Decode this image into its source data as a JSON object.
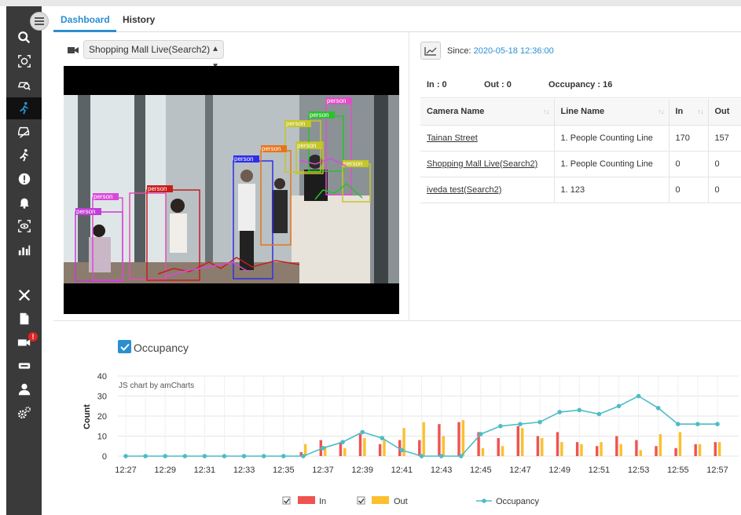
{
  "tabs": {
    "dashboard": "Dashboard",
    "history": "History"
  },
  "camera": {
    "selected": "Shopping Mall Live(Search2)"
  },
  "detections": [
    "person",
    "person",
    "person",
    "person",
    "person",
    "person",
    "person",
    "person",
    "person",
    "person"
  ],
  "since": {
    "label": "Since:",
    "value": "2020-05-18 12:36:00"
  },
  "summary": {
    "in": "In : 0",
    "out": "Out : 0",
    "occupancy": "Occupancy : 16"
  },
  "table": {
    "headers": [
      "Camera Name",
      "Line Name",
      "In",
      "Out"
    ],
    "rows": [
      [
        "Tainan Street",
        "1. People Counting Line",
        "170",
        "157"
      ],
      [
        "Shopping Mall Live(Search2)",
        "1. People Counting Line",
        "0",
        "0"
      ],
      [
        "iveda test(Search2)",
        "1. 123",
        "0",
        "0"
      ]
    ]
  },
  "chart_title": "Occupancy",
  "colors": {
    "accent": "#2a8fd0",
    "in": "#ef5350",
    "out": "#fbc02d",
    "occupancy": "#4dbcc8",
    "sidebar": "#3a3a3a"
  },
  "chart_data": {
    "type": "bar",
    "watermark": "JS chart by amCharts",
    "ylabel": "Count",
    "xlabel": "",
    "ylim": [
      0,
      40
    ],
    "yticks": [
      0,
      10,
      20,
      30,
      40
    ],
    "tick_labels": [
      "12:27",
      "12:29",
      "12:31",
      "12:33",
      "12:35",
      "12:37",
      "12:39",
      "12:41",
      "12:43",
      "12:45",
      "12:47",
      "12:49",
      "12:51",
      "12:53",
      "12:55",
      "12:57"
    ],
    "categories": [
      "12:27",
      "12:28",
      "12:29",
      "12:30",
      "12:31",
      "12:32",
      "12:33",
      "12:34",
      "12:35",
      "12:36",
      "12:37",
      "12:38",
      "12:39",
      "12:40",
      "12:41",
      "12:42",
      "12:43",
      "12:44",
      "12:45",
      "12:46",
      "12:47",
      "12:48",
      "12:49",
      "12:50",
      "12:51",
      "12:52",
      "12:53",
      "12:54",
      "12:55",
      "12:56",
      "12:57"
    ],
    "series": [
      {
        "name": "In",
        "type": "bar",
        "values": [
          0,
          0,
          0,
          0,
          0,
          0,
          0,
          0,
          0,
          2,
          8,
          7,
          11,
          6,
          8,
          8,
          16,
          17,
          12,
          9,
          15,
          10,
          12,
          7,
          5,
          10,
          8,
          5,
          4,
          6,
          7
        ]
      },
      {
        "name": "Out",
        "type": "bar",
        "values": [
          0,
          0,
          0,
          0,
          0,
          0,
          0,
          0,
          0,
          6,
          5,
          4,
          9,
          8,
          14,
          17,
          10,
          18,
          4,
          5,
          14,
          9,
          7,
          6,
          7,
          6,
          3,
          11,
          12,
          6,
          7
        ]
      },
      {
        "name": "Occupancy",
        "type": "line",
        "values": [
          0,
          0,
          0,
          0,
          0,
          0,
          0,
          0,
          0,
          0,
          4,
          7,
          12,
          9,
          3,
          0,
          0,
          0,
          11,
          15,
          16,
          17,
          22,
          23,
          21,
          25,
          30,
          24,
          16,
          16,
          16
        ]
      }
    ],
    "legend": "bottom"
  }
}
